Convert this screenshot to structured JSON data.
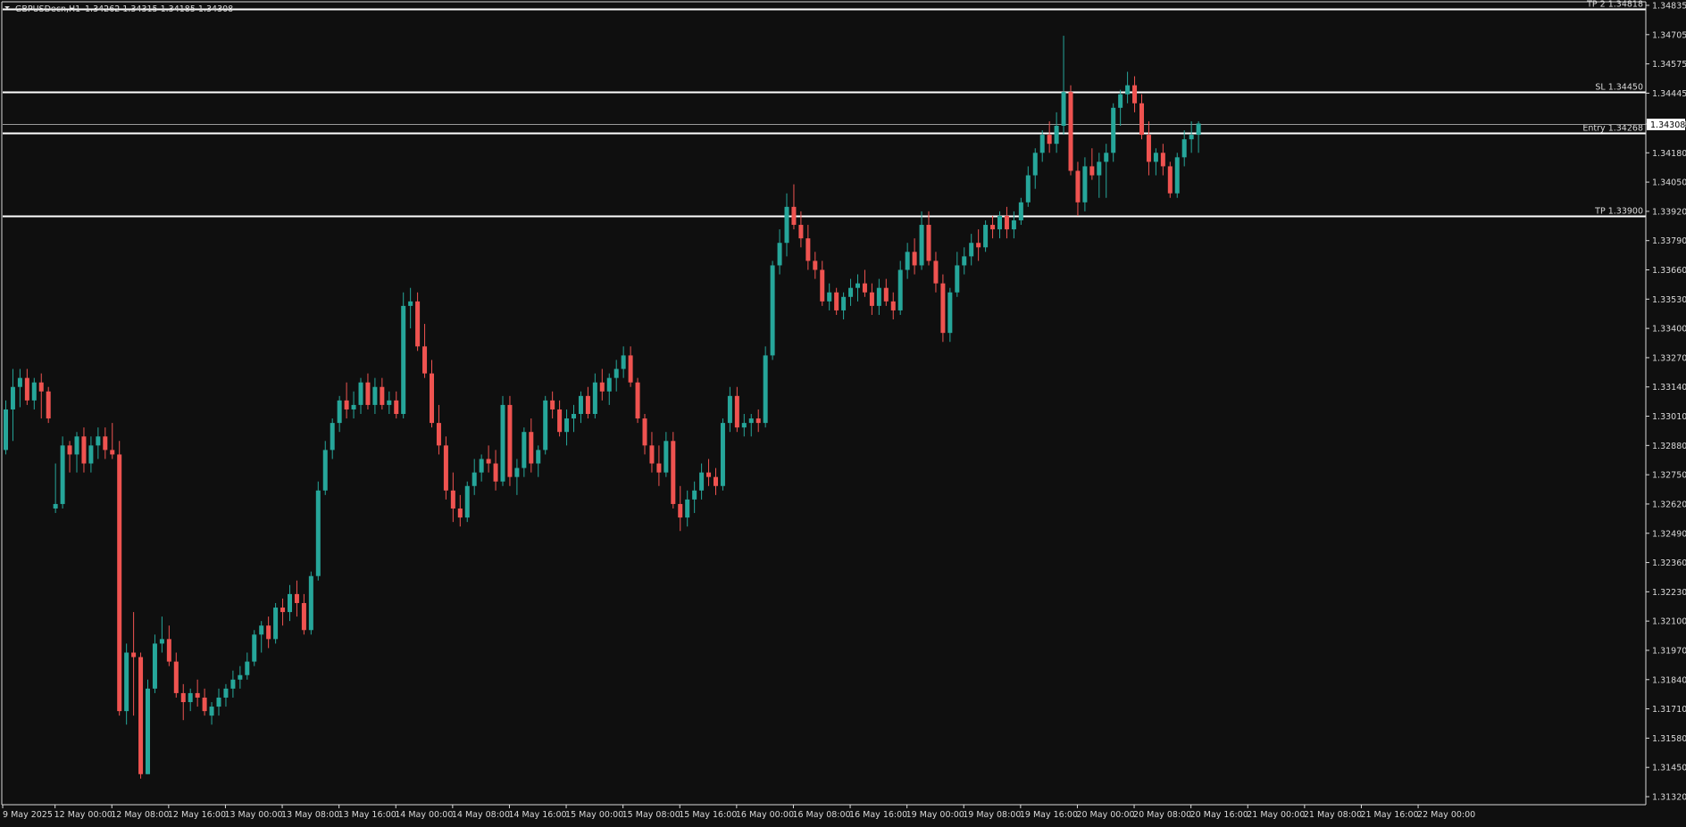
{
  "header": {
    "symbol_label": "GBPUSDecn,H1",
    "ohlc_label": "1.34262 1.34315 1.34185 1.34308"
  },
  "colors": {
    "background": "#0f0f0f",
    "bull": "#26a69a",
    "bear": "#ef5350",
    "axis": "#d9d9d9",
    "level_line": "#ffffff",
    "price_box_bg": "#ffffff",
    "price_box_text": "#000000"
  },
  "price_axis": {
    "labels": [
      "1.34835",
      "1.34705",
      "1.34575",
      "1.34445",
      "1.34308",
      "1.34180",
      "1.34050",
      "1.33920",
      "1.33790",
      "1.33660",
      "1.33530",
      "1.33400",
      "1.33270",
      "1.33140",
      "1.33010",
      "1.32880",
      "1.32750",
      "1.32620",
      "1.32490",
      "1.32360",
      "1.32230",
      "1.32100",
      "1.31970",
      "1.31840",
      "1.31710",
      "1.31580",
      "1.31450",
      "1.31320"
    ]
  },
  "current_price": {
    "value": 1.34308,
    "label": "1.34308"
  },
  "levels": [
    {
      "name": "tp2",
      "label": "TP 2 1.34818",
      "price": 1.34818
    },
    {
      "name": "sl",
      "label": "SL 1.34450",
      "price": 1.3445
    },
    {
      "name": "entry",
      "label": "Entry 1.34268",
      "price": 1.34268
    },
    {
      "name": "tp",
      "label": "TP 1.33900",
      "price": 1.339
    }
  ],
  "time_axis": {
    "labels": [
      "9 May 2025",
      "12 May 00:00",
      "12 May 08:00",
      "12 May 16:00",
      "13 May 00:00",
      "13 May 08:00",
      "13 May 16:00",
      "14 May 00:00",
      "14 May 08:00",
      "14 May 16:00",
      "15 May 00:00",
      "15 May 08:00",
      "15 May 16:00",
      "16 May 00:00",
      "16 May 08:00",
      "16 May 16:00",
      "19 May 00:00",
      "19 May 08:00",
      "19 May 16:00",
      "20 May 00:00",
      "20 May 08:00",
      "20 May 16:00",
      "21 May 00:00",
      "21 May 08:00",
      "21 May 16:00",
      "22 May 00:00"
    ]
  },
  "chart_data": {
    "type": "candlestick",
    "title": "GBPUSDecn,H1",
    "ylim": [
      1.3126,
      1.3489
    ],
    "grid": false,
    "candle_spacing_bars_per_label": 8,
    "candles": [
      [
        1.3286,
        1.3308,
        1.3284,
        1.3304
      ],
      [
        1.3304,
        1.3322,
        1.329,
        1.3314
      ],
      [
        1.3314,
        1.3322,
        1.3305,
        1.3318
      ],
      [
        1.3318,
        1.3322,
        1.3306,
        1.3308
      ],
      [
        1.3308,
        1.3318,
        1.3304,
        1.3316
      ],
      [
        1.3316,
        1.332,
        1.33,
        1.3312
      ],
      [
        1.3312,
        1.3314,
        1.3298,
        1.33
      ],
      [
        1.326,
        1.328,
        1.3258,
        1.3262
      ],
      [
        1.3262,
        1.3292,
        1.326,
        1.3288
      ],
      [
        1.3288,
        1.329,
        1.3276,
        1.3284
      ],
      [
        1.3284,
        1.3294,
        1.3276,
        1.3292
      ],
      [
        1.3292,
        1.3296,
        1.3276,
        1.328
      ],
      [
        1.328,
        1.3292,
        1.3276,
        1.3288
      ],
      [
        1.3288,
        1.3296,
        1.3282,
        1.3292
      ],
      [
        1.3292,
        1.3296,
        1.3282,
        1.3286
      ],
      [
        1.3286,
        1.3298,
        1.3282,
        1.3284
      ],
      [
        1.3284,
        1.329,
        1.3168,
        1.317
      ],
      [
        1.317,
        1.32,
        1.3164,
        1.3196
      ],
      [
        1.3196,
        1.3214,
        1.3168,
        1.3194
      ],
      [
        1.3194,
        1.3196,
        1.314,
        1.3142
      ],
      [
        1.3142,
        1.3184,
        1.3142,
        1.318
      ],
      [
        1.318,
        1.3204,
        1.3178,
        1.32
      ],
      [
        1.32,
        1.3212,
        1.3196,
        1.3202
      ],
      [
        1.3202,
        1.3208,
        1.319,
        1.3192
      ],
      [
        1.3192,
        1.3196,
        1.3176,
        1.3178
      ],
      [
        1.3178,
        1.3182,
        1.3166,
        1.3174
      ],
      [
        1.3174,
        1.318,
        1.317,
        1.3178
      ],
      [
        1.3178,
        1.3184,
        1.3172,
        1.3176
      ],
      [
        1.3176,
        1.318,
        1.3168,
        1.317
      ],
      [
        1.3168,
        1.3174,
        1.3164,
        1.3172
      ],
      [
        1.3172,
        1.318,
        1.3168,
        1.3176
      ],
      [
        1.3176,
        1.3182,
        1.3172,
        1.318
      ],
      [
        1.318,
        1.3188,
        1.3176,
        1.3184
      ],
      [
        1.3184,
        1.319,
        1.318,
        1.3186
      ],
      [
        1.3186,
        1.3196,
        1.3184,
        1.3192
      ],
      [
        1.3192,
        1.3206,
        1.319,
        1.3204
      ],
      [
        1.3204,
        1.321,
        1.3196,
        1.3208
      ],
      [
        1.3208,
        1.3212,
        1.3198,
        1.3202
      ],
      [
        1.3202,
        1.3218,
        1.32,
        1.3216
      ],
      [
        1.3216,
        1.322,
        1.3208,
        1.3214
      ],
      [
        1.3214,
        1.3226,
        1.321,
        1.3222
      ],
      [
        1.3222,
        1.3228,
        1.3212,
        1.3218
      ],
      [
        1.3218,
        1.3222,
        1.3204,
        1.3206
      ],
      [
        1.3206,
        1.3232,
        1.3204,
        1.323
      ],
      [
        1.323,
        1.3272,
        1.3228,
        1.3268
      ],
      [
        1.3268,
        1.329,
        1.3266,
        1.3286
      ],
      [
        1.3286,
        1.33,
        1.3282,
        1.3298
      ],
      [
        1.3298,
        1.331,
        1.3294,
        1.3308
      ],
      [
        1.3308,
        1.3316,
        1.33,
        1.3304
      ],
      [
        1.3304,
        1.3312,
        1.33,
        1.3306
      ],
      [
        1.3306,
        1.3318,
        1.3302,
        1.3316
      ],
      [
        1.3316,
        1.332,
        1.3304,
        1.3306
      ],
      [
        1.3306,
        1.3318,
        1.3302,
        1.3314
      ],
      [
        1.3314,
        1.3318,
        1.3304,
        1.3306
      ],
      [
        1.3306,
        1.3312,
        1.3302,
        1.3308
      ],
      [
        1.3308,
        1.3312,
        1.33,
        1.3302
      ],
      [
        1.3302,
        1.3356,
        1.33,
        1.335
      ],
      [
        1.335,
        1.3358,
        1.334,
        1.3352
      ],
      [
        1.3352,
        1.3356,
        1.333,
        1.3332
      ],
      [
        1.3332,
        1.3342,
        1.3318,
        1.332
      ],
      [
        1.332,
        1.3326,
        1.3296,
        1.3298
      ],
      [
        1.3298,
        1.3306,
        1.3284,
        1.3288
      ],
      [
        1.3288,
        1.3292,
        1.3264,
        1.3268
      ],
      [
        1.3268,
        1.3276,
        1.3254,
        1.326
      ],
      [
        1.326,
        1.3266,
        1.3252,
        1.3256
      ],
      [
        1.3256,
        1.3272,
        1.3254,
        1.327
      ],
      [
        1.327,
        1.3282,
        1.3266,
        1.3276
      ],
      [
        1.3276,
        1.3284,
        1.3272,
        1.3282
      ],
      [
        1.3282,
        1.3288,
        1.3276,
        1.328
      ],
      [
        1.328,
        1.3286,
        1.3268,
        1.3272
      ],
      [
        1.3272,
        1.331,
        1.327,
        1.3306
      ],
      [
        1.3306,
        1.331,
        1.327,
        1.3274
      ],
      [
        1.3274,
        1.3282,
        1.3266,
        1.3278
      ],
      [
        1.3278,
        1.3296,
        1.3274,
        1.3294
      ],
      [
        1.3294,
        1.33,
        1.3276,
        1.328
      ],
      [
        1.328,
        1.3288,
        1.3274,
        1.3286
      ],
      [
        1.3286,
        1.331,
        1.3284,
        1.3308
      ],
      [
        1.3308,
        1.3312,
        1.33,
        1.3304
      ],
      [
        1.3304,
        1.3308,
        1.3292,
        1.3294
      ],
      [
        1.3294,
        1.3304,
        1.3288,
        1.33
      ],
      [
        1.33,
        1.3306,
        1.3294,
        1.3302
      ],
      [
        1.3302,
        1.3312,
        1.3298,
        1.331
      ],
      [
        1.331,
        1.3314,
        1.33,
        1.3302
      ],
      [
        1.3302,
        1.332,
        1.33,
        1.3316
      ],
      [
        1.3316,
        1.3322,
        1.3308,
        1.3312
      ],
      [
        1.3312,
        1.332,
        1.3306,
        1.3318
      ],
      [
        1.3318,
        1.3326,
        1.3312,
        1.3322
      ],
      [
        1.3322,
        1.3332,
        1.3318,
        1.3328
      ],
      [
        1.3328,
        1.3332,
        1.3314,
        1.3316
      ],
      [
        1.3316,
        1.3318,
        1.3298,
        1.33
      ],
      [
        1.33,
        1.3302,
        1.3284,
        1.3288
      ],
      [
        1.3288,
        1.3294,
        1.3276,
        1.328
      ],
      [
        1.328,
        1.3288,
        1.327,
        1.3276
      ],
      [
        1.3276,
        1.3294,
        1.3274,
        1.329
      ],
      [
        1.329,
        1.3294,
        1.326,
        1.3262
      ],
      [
        1.3262,
        1.327,
        1.325,
        1.3256
      ],
      [
        1.3256,
        1.3268,
        1.3252,
        1.3264
      ],
      [
        1.3264,
        1.3272,
        1.3258,
        1.3268
      ],
      [
        1.3268,
        1.328,
        1.3264,
        1.3276
      ],
      [
        1.3276,
        1.3282,
        1.327,
        1.3274
      ],
      [
        1.3274,
        1.3278,
        1.3266,
        1.327
      ],
      [
        1.327,
        1.33,
        1.3268,
        1.3298
      ],
      [
        1.3298,
        1.3314,
        1.3294,
        1.331
      ],
      [
        1.331,
        1.3314,
        1.3294,
        1.3296
      ],
      [
        1.3296,
        1.3302,
        1.3292,
        1.3298
      ],
      [
        1.3298,
        1.3302,
        1.3292,
        1.33
      ],
      [
        1.33,
        1.3304,
        1.3294,
        1.3298
      ],
      [
        1.3298,
        1.3332,
        1.3296,
        1.3328
      ],
      [
        1.3328,
        1.337,
        1.3326,
        1.3368
      ],
      [
        1.3368,
        1.3384,
        1.3364,
        1.3378
      ],
      [
        1.3378,
        1.34,
        1.3372,
        1.3394
      ],
      [
        1.3394,
        1.3404,
        1.3384,
        1.3386
      ],
      [
        1.3386,
        1.3392,
        1.3376,
        1.338
      ],
      [
        1.338,
        1.3386,
        1.3366,
        1.337
      ],
      [
        1.337,
        1.3374,
        1.3362,
        1.3366
      ],
      [
        1.3366,
        1.337,
        1.335,
        1.3352
      ],
      [
        1.3352,
        1.336,
        1.3348,
        1.3356
      ],
      [
        1.3356,
        1.3358,
        1.3346,
        1.3348
      ],
      [
        1.3348,
        1.3356,
        1.3344,
        1.3354
      ],
      [
        1.3354,
        1.3362,
        1.335,
        1.3358
      ],
      [
        1.3358,
        1.3364,
        1.3352,
        1.336
      ],
      [
        1.336,
        1.3366,
        1.3354,
        1.3356
      ],
      [
        1.3356,
        1.336,
        1.3346,
        1.335
      ],
      [
        1.335,
        1.3362,
        1.3346,
        1.3358
      ],
      [
        1.3358,
        1.3362,
        1.335,
        1.3352
      ],
      [
        1.3352,
        1.3356,
        1.3344,
        1.3348
      ],
      [
        1.3348,
        1.337,
        1.3346,
        1.3366
      ],
      [
        1.3366,
        1.3378,
        1.3362,
        1.3374
      ],
      [
        1.3374,
        1.338,
        1.3364,
        1.3368
      ],
      [
        1.3368,
        1.3392,
        1.3366,
        1.3386
      ],
      [
        1.3386,
        1.3392,
        1.3368,
        1.337
      ],
      [
        1.337,
        1.3374,
        1.3356,
        1.336
      ],
      [
        1.336,
        1.3364,
        1.3334,
        1.3338
      ],
      [
        1.3338,
        1.3358,
        1.3334,
        1.3356
      ],
      [
        1.3356,
        1.3374,
        1.3354,
        1.3368
      ],
      [
        1.3368,
        1.3376,
        1.3364,
        1.3372
      ],
      [
        1.3372,
        1.3382,
        1.3368,
        1.3378
      ],
      [
        1.3378,
        1.3384,
        1.337,
        1.3376
      ],
      [
        1.3376,
        1.3388,
        1.3374,
        1.3386
      ],
      [
        1.3386,
        1.339,
        1.338,
        1.3384
      ],
      [
        1.3384,
        1.3392,
        1.338,
        1.339
      ],
      [
        1.339,
        1.3394,
        1.338,
        1.3384
      ],
      [
        1.3384,
        1.3392,
        1.338,
        1.3388
      ],
      [
        1.3388,
        1.3398,
        1.3386,
        1.3396
      ],
      [
        1.3396,
        1.3412,
        1.3394,
        1.3408
      ],
      [
        1.3408,
        1.342,
        1.3402,
        1.3418
      ],
      [
        1.3418,
        1.3428,
        1.3414,
        1.3426
      ],
      [
        1.3426,
        1.3432,
        1.3418,
        1.3422
      ],
      [
        1.3422,
        1.3436,
        1.3418,
        1.343
      ],
      [
        1.343,
        1.347,
        1.3426,
        1.3445
      ],
      [
        1.3445,
        1.3448,
        1.3408,
        1.341
      ],
      [
        1.341,
        1.3414,
        1.339,
        1.3396
      ],
      [
        1.3396,
        1.3416,
        1.3392,
        1.3412
      ],
      [
        1.3412,
        1.342,
        1.3406,
        1.3408
      ],
      [
        1.3408,
        1.3418,
        1.3398,
        1.3414
      ],
      [
        1.3414,
        1.3422,
        1.3398,
        1.3418
      ],
      [
        1.3418,
        1.344,
        1.3414,
        1.3438
      ],
      [
        1.3438,
        1.3446,
        1.343,
        1.3444
      ],
      [
        1.3444,
        1.3454,
        1.344,
        1.3448
      ],
      [
        1.3448,
        1.3452,
        1.3436,
        1.344
      ],
      [
        1.344,
        1.3444,
        1.3424,
        1.3426
      ],
      [
        1.3426,
        1.3432,
        1.3408,
        1.3414
      ],
      [
        1.3414,
        1.342,
        1.3408,
        1.3418
      ],
      [
        1.3418,
        1.3422,
        1.3408,
        1.3412
      ],
      [
        1.3412,
        1.3414,
        1.3398,
        1.34
      ],
      [
        1.34,
        1.3418,
        1.3398,
        1.3416
      ],
      [
        1.3416,
        1.3428,
        1.3412,
        1.3424
      ],
      [
        1.3424,
        1.3432,
        1.3418,
        1.3426
      ],
      [
        1.3426,
        1.3432,
        1.3418,
        1.3431
      ]
    ]
  }
}
